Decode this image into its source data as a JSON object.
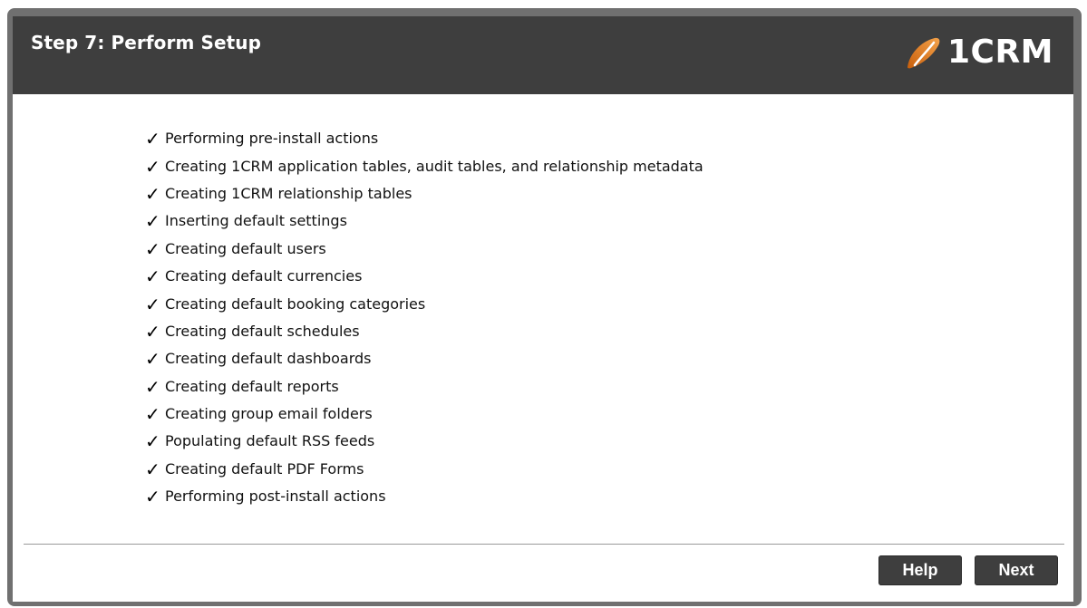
{
  "header": {
    "title": "Step 7: Perform Setup",
    "logo_text": "1CRM",
    "logo_icon": "1crm-logo-icon"
  },
  "tasks": [
    {
      "label": "Performing pre-install actions",
      "status": "done"
    },
    {
      "label": "Creating 1CRM application tables, audit tables, and relationship metadata",
      "status": "done"
    },
    {
      "label": "Creating 1CRM relationship tables",
      "status": "done"
    },
    {
      "label": "Inserting default settings",
      "status": "done"
    },
    {
      "label": "Creating default users",
      "status": "done"
    },
    {
      "label": "Creating default currencies",
      "status": "done"
    },
    {
      "label": "Creating default booking categories",
      "status": "done"
    },
    {
      "label": "Creating default schedules",
      "status": "done"
    },
    {
      "label": "Creating default dashboards",
      "status": "done"
    },
    {
      "label": "Creating default reports",
      "status": "done"
    },
    {
      "label": "Creating group email folders",
      "status": "done"
    },
    {
      "label": "Populating default RSS feeds",
      "status": "done"
    },
    {
      "label": "Creating default PDF Forms",
      "status": "done"
    },
    {
      "label": "Performing post-install actions",
      "status": "done"
    }
  ],
  "check_glyph": "✓",
  "footer": {
    "help_label": "Help",
    "next_label": "Next"
  },
  "colors": {
    "frame": "#707070",
    "header_bg": "#3e3e3e",
    "header_text": "#ffffff",
    "logo_accent": "#e8851e",
    "button_bg": "#3e3e3e",
    "button_text": "#ffffff"
  }
}
